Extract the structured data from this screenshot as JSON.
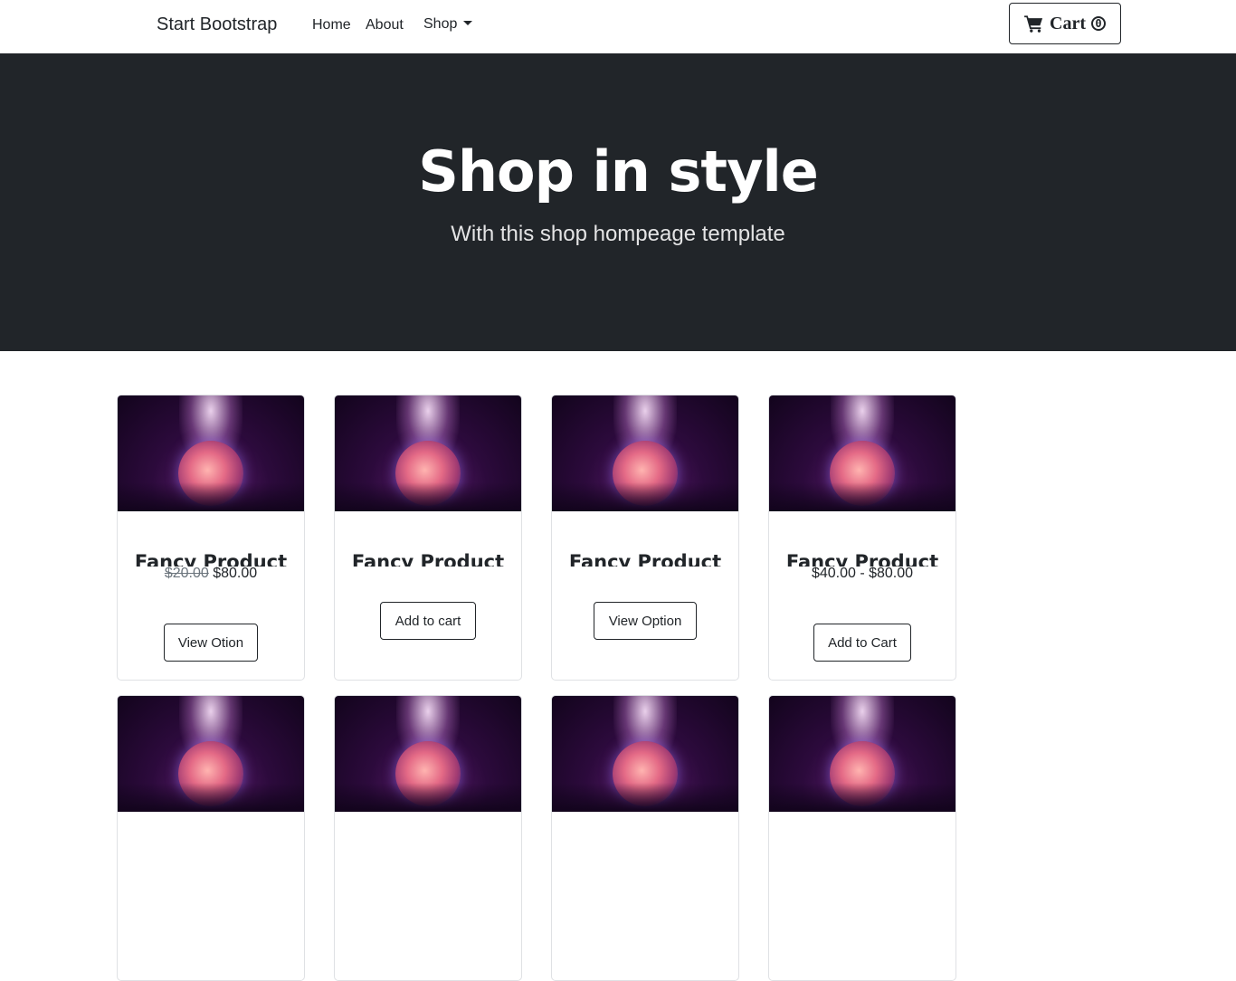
{
  "navbar": {
    "brand": "Start Bootstrap",
    "links": {
      "home": "Home",
      "about": "About",
      "shop": "Shop"
    },
    "cart": {
      "label": "Cart",
      "count": "0"
    }
  },
  "hero": {
    "title": "Shop in style",
    "subtitle": "With this shop hompeage template"
  },
  "products": [
    {
      "name": "Fancy Product",
      "old_price": "$20.00",
      "price": "$80.00",
      "button": "View Otion"
    },
    {
      "name": "Fancy Product",
      "button": "Add to cart"
    },
    {
      "name": "Fancy Product",
      "button": "View Option"
    },
    {
      "name": "Fancy Product",
      "price": "$40.00 - $80.00",
      "button": "Add to Cart"
    }
  ],
  "colors": {
    "dark": "#212529",
    "border": "#dfe1e4",
    "hero_text": "#ffffff"
  },
  "icons": {
    "cart": "cart-icon",
    "dropdown": "caret-down-icon"
  }
}
